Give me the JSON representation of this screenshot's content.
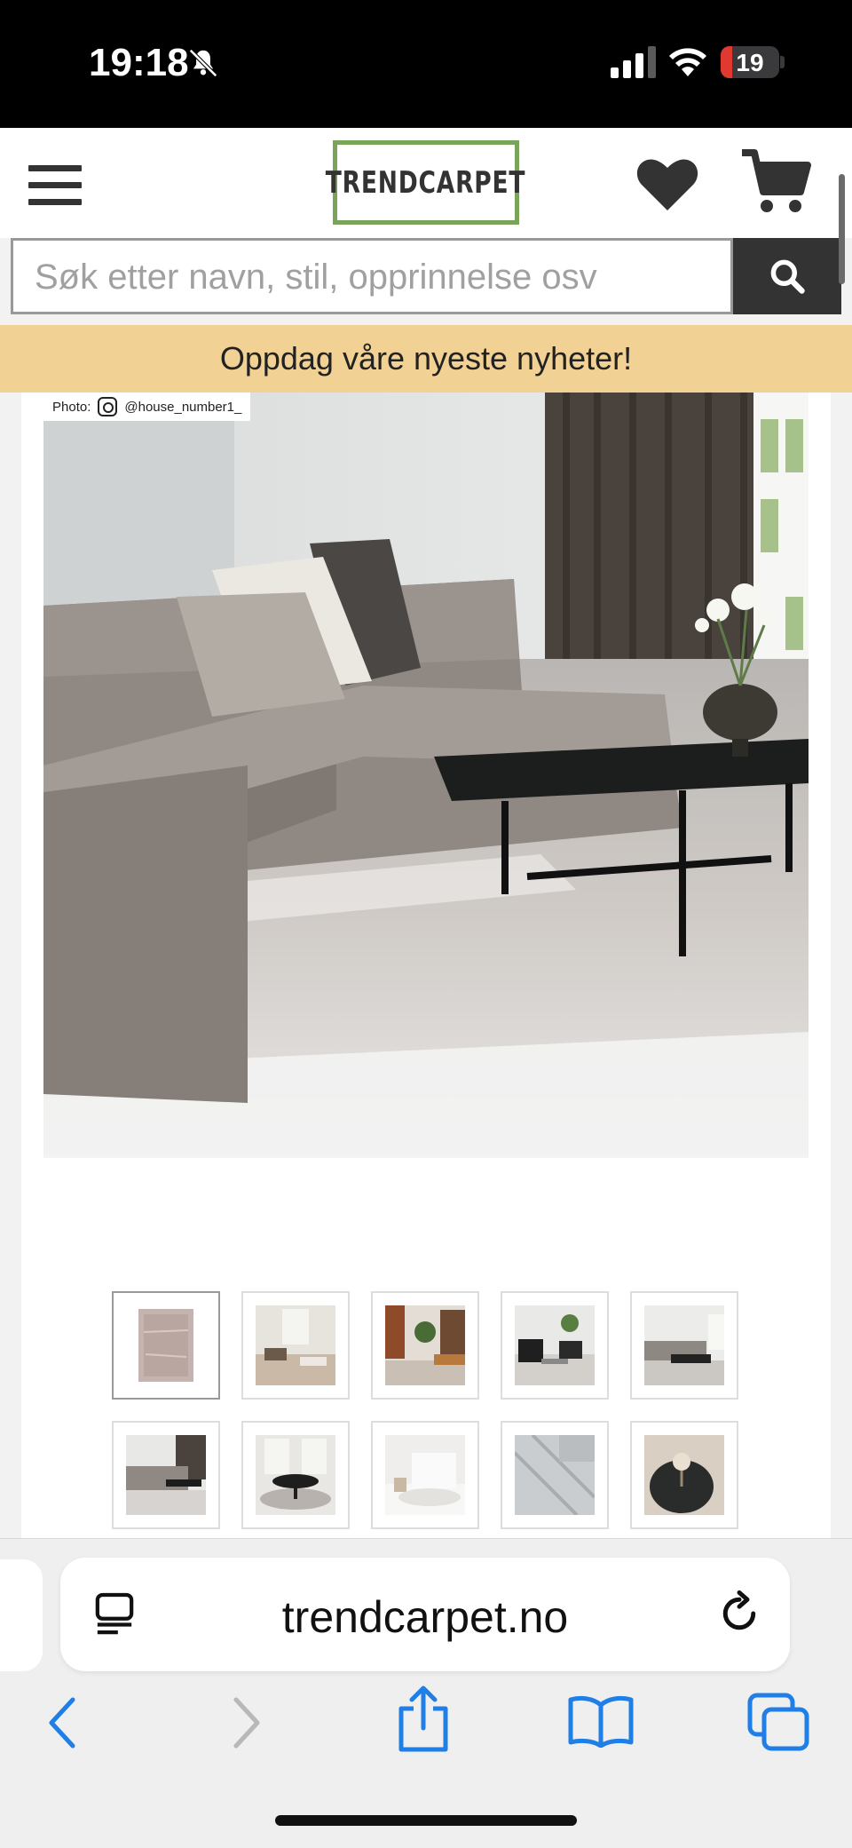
{
  "status_bar": {
    "time": "19:18",
    "battery": "19",
    "icons": [
      "bell-slash-icon",
      "signal-icon",
      "wifi-icon",
      "battery-icon"
    ]
  },
  "header": {
    "logo_text": "TRENDCARPET",
    "icons": [
      "hamburger-menu-icon",
      "heart-icon",
      "cart-icon"
    ]
  },
  "search": {
    "placeholder": "Søk etter navn, stil, opprinnelse osv",
    "button_icon": "search-icon"
  },
  "banner": {
    "text": "Oppdag våre nyeste nyheter!"
  },
  "product_image": {
    "credit_label": "Photo:",
    "credit_handle": "@house_number1_"
  },
  "thumbnails": [
    {
      "index": 1,
      "active": true,
      "scene": "carpet-topview"
    },
    {
      "index": 2,
      "active": false,
      "scene": "living-room"
    },
    {
      "index": 3,
      "active": false,
      "scene": "shelves-room"
    },
    {
      "index": 4,
      "active": false,
      "scene": "lounge-chairs"
    },
    {
      "index": 5,
      "active": false,
      "scene": "sofa-table"
    },
    {
      "index": 6,
      "active": false,
      "scene": "grey-sofa"
    },
    {
      "index": 7,
      "active": false,
      "scene": "dining-table"
    },
    {
      "index": 8,
      "active": false,
      "scene": "white-room"
    },
    {
      "index": 9,
      "active": false,
      "scene": "carpet-closeup"
    },
    {
      "index": 10,
      "active": false,
      "scene": "round-table-flowers"
    }
  ],
  "browser": {
    "url": "trendcarpet.no",
    "icons": [
      "reader-icon",
      "reload-icon",
      "back-icon",
      "forward-icon",
      "share-icon",
      "bookmarks-icon",
      "tabs-icon"
    ]
  },
  "colors": {
    "brand_green": "#7aa45a",
    "banner": "#f1d294",
    "header_dark": "#333333",
    "safari_blue": "#1f7fe6"
  }
}
